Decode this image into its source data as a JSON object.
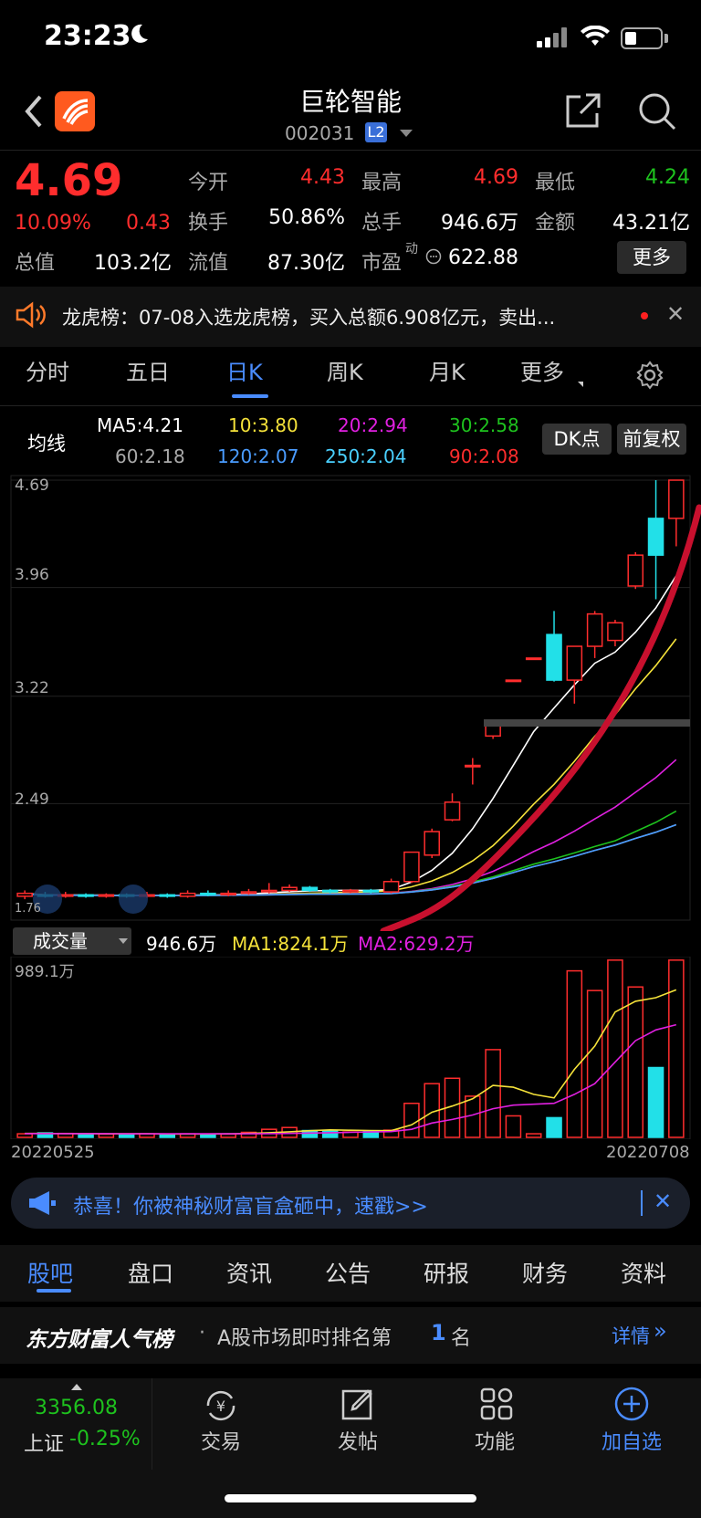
{
  "status_bar": {
    "time": "23:23"
  },
  "header": {
    "title": "巨轮智能",
    "code": "002031",
    "level_badge": "L2"
  },
  "quote": {
    "price": "4.69",
    "change_pct": "10.09%",
    "change": "0.43",
    "open_label": "今开",
    "open": "4.43",
    "high_label": "最高",
    "high": "4.69",
    "low_label": "最低",
    "low": "4.24",
    "turnover_label": "换手",
    "turnover": "50.86%",
    "volume_label": "总手",
    "volume": "946.6万",
    "amount_label": "金额",
    "amount": "43.21亿",
    "mktcap_label": "总值",
    "mktcap": "103.2亿",
    "float_label": "流值",
    "float": "87.30亿",
    "pe_label": "市盈",
    "pe_sup": "动",
    "pe": "622.88",
    "more_label": "更多"
  },
  "banner": {
    "text": "龙虎榜：07-08入选龙虎榜，买入总额6.908亿元，卖出..."
  },
  "chart_tabs": [
    "分时",
    "五日",
    "日K",
    "周K",
    "月K",
    "更多"
  ],
  "ma_legend": {
    "title": "均线",
    "ma5": "MA5:4.21",
    "ma10": "10:3.80",
    "ma20": "20:2.94",
    "ma30": "30:2.58",
    "ma60": "60:2.18",
    "ma120": "120:2.07",
    "ma250": "250:2.04",
    "ma90": "90:2.08",
    "dk_label": "DK点",
    "adj_label": "前复权"
  },
  "colors": {
    "up": "#ff2d2d",
    "down": "#22e0e8",
    "ma5": "#ffffff",
    "ma10": "#f5e23a",
    "ma20": "#e020e0",
    "ma30": "#1ec21e",
    "ma60": "#888888",
    "ma120": "#4a9cff",
    "accent": "#4a8cff"
  },
  "price_axis": [
    "4.69",
    "3.96",
    "3.22",
    "2.49",
    "1.76"
  ],
  "volume": {
    "label": "成交量",
    "value": "946.6万",
    "ma1": "MA1:824.1万",
    "ma2": "MA2:629.2万",
    "max_label": "989.1万",
    "start_date": "20220525",
    "end_date": "20220708"
  },
  "chart_data": {
    "type": "candlestick",
    "ylim": [
      1.76,
      4.69
    ],
    "candles": [
      {
        "o": 1.86,
        "c": 1.88,
        "h": 1.9,
        "l": 1.84,
        "up": true
      },
      {
        "o": 1.87,
        "c": 1.86,
        "h": 1.89,
        "l": 1.85,
        "up": false
      },
      {
        "o": 1.86,
        "c": 1.87,
        "h": 1.89,
        "l": 1.85,
        "up": true
      },
      {
        "o": 1.87,
        "c": 1.86,
        "h": 1.88,
        "l": 1.85,
        "up": false
      },
      {
        "o": 1.86,
        "c": 1.87,
        "h": 1.88,
        "l": 1.85,
        "up": true
      },
      {
        "o": 1.87,
        "c": 1.86,
        "h": 1.88,
        "l": 1.85,
        "up": false
      },
      {
        "o": 1.86,
        "c": 1.87,
        "h": 1.89,
        "l": 1.85,
        "up": true
      },
      {
        "o": 1.87,
        "c": 1.86,
        "h": 1.88,
        "l": 1.85,
        "up": false
      },
      {
        "o": 1.86,
        "c": 1.88,
        "h": 1.9,
        "l": 1.85,
        "up": true
      },
      {
        "o": 1.88,
        "c": 1.87,
        "h": 1.9,
        "l": 1.86,
        "up": false
      },
      {
        "o": 1.87,
        "c": 1.88,
        "h": 1.9,
        "l": 1.86,
        "up": true
      },
      {
        "o": 1.88,
        "c": 1.89,
        "h": 1.91,
        "l": 1.87,
        "up": true
      },
      {
        "o": 1.89,
        "c": 1.9,
        "h": 1.95,
        "l": 1.88,
        "up": true
      },
      {
        "o": 1.9,
        "c": 1.92,
        "h": 1.94,
        "l": 1.89,
        "up": true
      },
      {
        "o": 1.92,
        "c": 1.9,
        "h": 1.93,
        "l": 1.89,
        "up": false
      },
      {
        "o": 1.9,
        "c": 1.89,
        "h": 1.91,
        "l": 1.88,
        "up": false
      },
      {
        "o": 1.89,
        "c": 1.9,
        "h": 1.91,
        "l": 1.88,
        "up": true
      },
      {
        "o": 1.9,
        "c": 1.89,
        "h": 1.91,
        "l": 1.88,
        "up": false
      },
      {
        "o": 1.89,
        "c": 1.96,
        "h": 1.98,
        "l": 1.88,
        "up": true
      },
      {
        "o": 1.96,
        "c": 2.16,
        "h": 2.16,
        "l": 1.95,
        "up": true
      },
      {
        "o": 2.14,
        "c": 2.3,
        "h": 2.32,
        "l": 2.12,
        "up": true
      },
      {
        "o": 2.38,
        "c": 2.5,
        "h": 2.56,
        "l": 2.37,
        "up": true
      },
      {
        "o": 2.75,
        "c": 2.75,
        "h": 2.8,
        "l": 2.62,
        "up": true
      },
      {
        "o": 2.95,
        "c": 3.02,
        "h": 3.06,
        "l": 2.93,
        "up": true
      },
      {
        "o": 3.33,
        "c": 3.33,
        "h": 3.33,
        "l": 3.33,
        "up": true
      },
      {
        "o": 3.48,
        "c": 3.48,
        "h": 3.48,
        "l": 3.48,
        "up": true
      },
      {
        "o": 3.64,
        "c": 3.33,
        "h": 3.8,
        "l": 3.32,
        "up": false
      },
      {
        "o": 3.33,
        "c": 3.56,
        "h": 3.56,
        "l": 3.17,
        "up": true
      },
      {
        "o": 3.56,
        "c": 3.78,
        "h": 3.8,
        "l": 3.48,
        "up": true
      },
      {
        "o": 3.6,
        "c": 3.72,
        "h": 3.74,
        "l": 3.56,
        "up": true
      },
      {
        "o": 3.97,
        "c": 4.18,
        "h": 4.2,
        "l": 3.95,
        "up": true
      },
      {
        "o": 4.43,
        "c": 4.18,
        "h": 4.69,
        "l": 3.88,
        "up": false
      },
      {
        "o": 4.43,
        "c": 4.69,
        "h": 4.69,
        "l": 4.24,
        "up": true
      }
    ],
    "vol_ylim": [
      0,
      989.1
    ],
    "volumes": [
      20,
      25,
      22,
      20,
      18,
      18,
      20,
      18,
      20,
      19,
      18,
      28,
      45,
      55,
      38,
      35,
      30,
      35,
      40,
      190,
      300,
      330,
      230,
      490,
      120,
      20,
      110,
      930,
      820,
      990,
      840,
      390,
      990
    ],
    "vol_ma1": [
      22,
      22,
      21,
      21,
      20,
      20,
      20,
      19,
      19,
      19,
      20,
      22,
      26,
      31,
      37,
      42,
      40,
      38,
      37,
      70,
      140,
      175,
      215,
      290,
      280,
      240,
      220,
      380,
      510,
      700,
      760,
      780,
      824
    ],
    "vol_ma2": [
      21,
      21,
      21,
      21,
      21,
      20,
      20,
      20,
      20,
      20,
      20,
      20,
      21,
      22,
      24,
      26,
      28,
      30,
      32,
      45,
      80,
      100,
      125,
      160,
      180,
      185,
      190,
      240,
      300,
      420,
      540,
      600,
      629
    ]
  },
  "notice": {
    "text": "恭喜！你被神秘财富盲盒砸中，速戳>>"
  },
  "bottom_tabs": [
    "股吧",
    "盘口",
    "资讯",
    "公告",
    "研报",
    "财务",
    "资料"
  ],
  "rank": {
    "brand": "东方财富人气榜",
    "dot": "·",
    "text": "A股市场即时排名第",
    "num": "1",
    "suffix": "名",
    "detail": "详情"
  },
  "footer": {
    "index_value": "3356.08",
    "index_name": "上证",
    "index_change": "-0.25%",
    "trade": "交易",
    "post": "发帖",
    "func": "功能",
    "watch": "加自选"
  }
}
